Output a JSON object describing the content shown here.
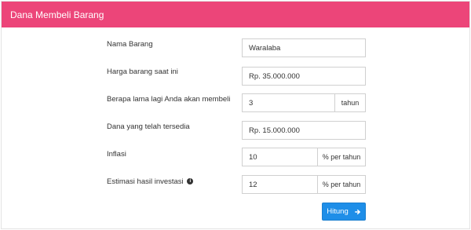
{
  "header": {
    "title": "Dana Membeli Barang"
  },
  "form": {
    "nama_barang": {
      "label": "Nama Barang",
      "value": "Waralaba"
    },
    "harga": {
      "label": "Harga barang saat ini",
      "value": "Rp. 35.000.000"
    },
    "lama": {
      "label": "Berapa lama lagi Anda akan membeli",
      "value": "3",
      "suffix": "tahun"
    },
    "dana": {
      "label": "Dana yang telah tersedia",
      "value": "Rp. 15.000.000"
    },
    "inflasi": {
      "label": "Inflasi",
      "value": "10",
      "suffix": "% per tahun"
    },
    "estimasi": {
      "label": "Estimasi hasil investasi",
      "value": "12",
      "suffix": "% per tahun",
      "icon": "info-circle-icon"
    }
  },
  "button": {
    "label": "Hitung",
    "icon": "arrow-right-icon"
  },
  "colors": {
    "header_bg": "#ec4579",
    "button_bg": "#1e8ee8"
  }
}
